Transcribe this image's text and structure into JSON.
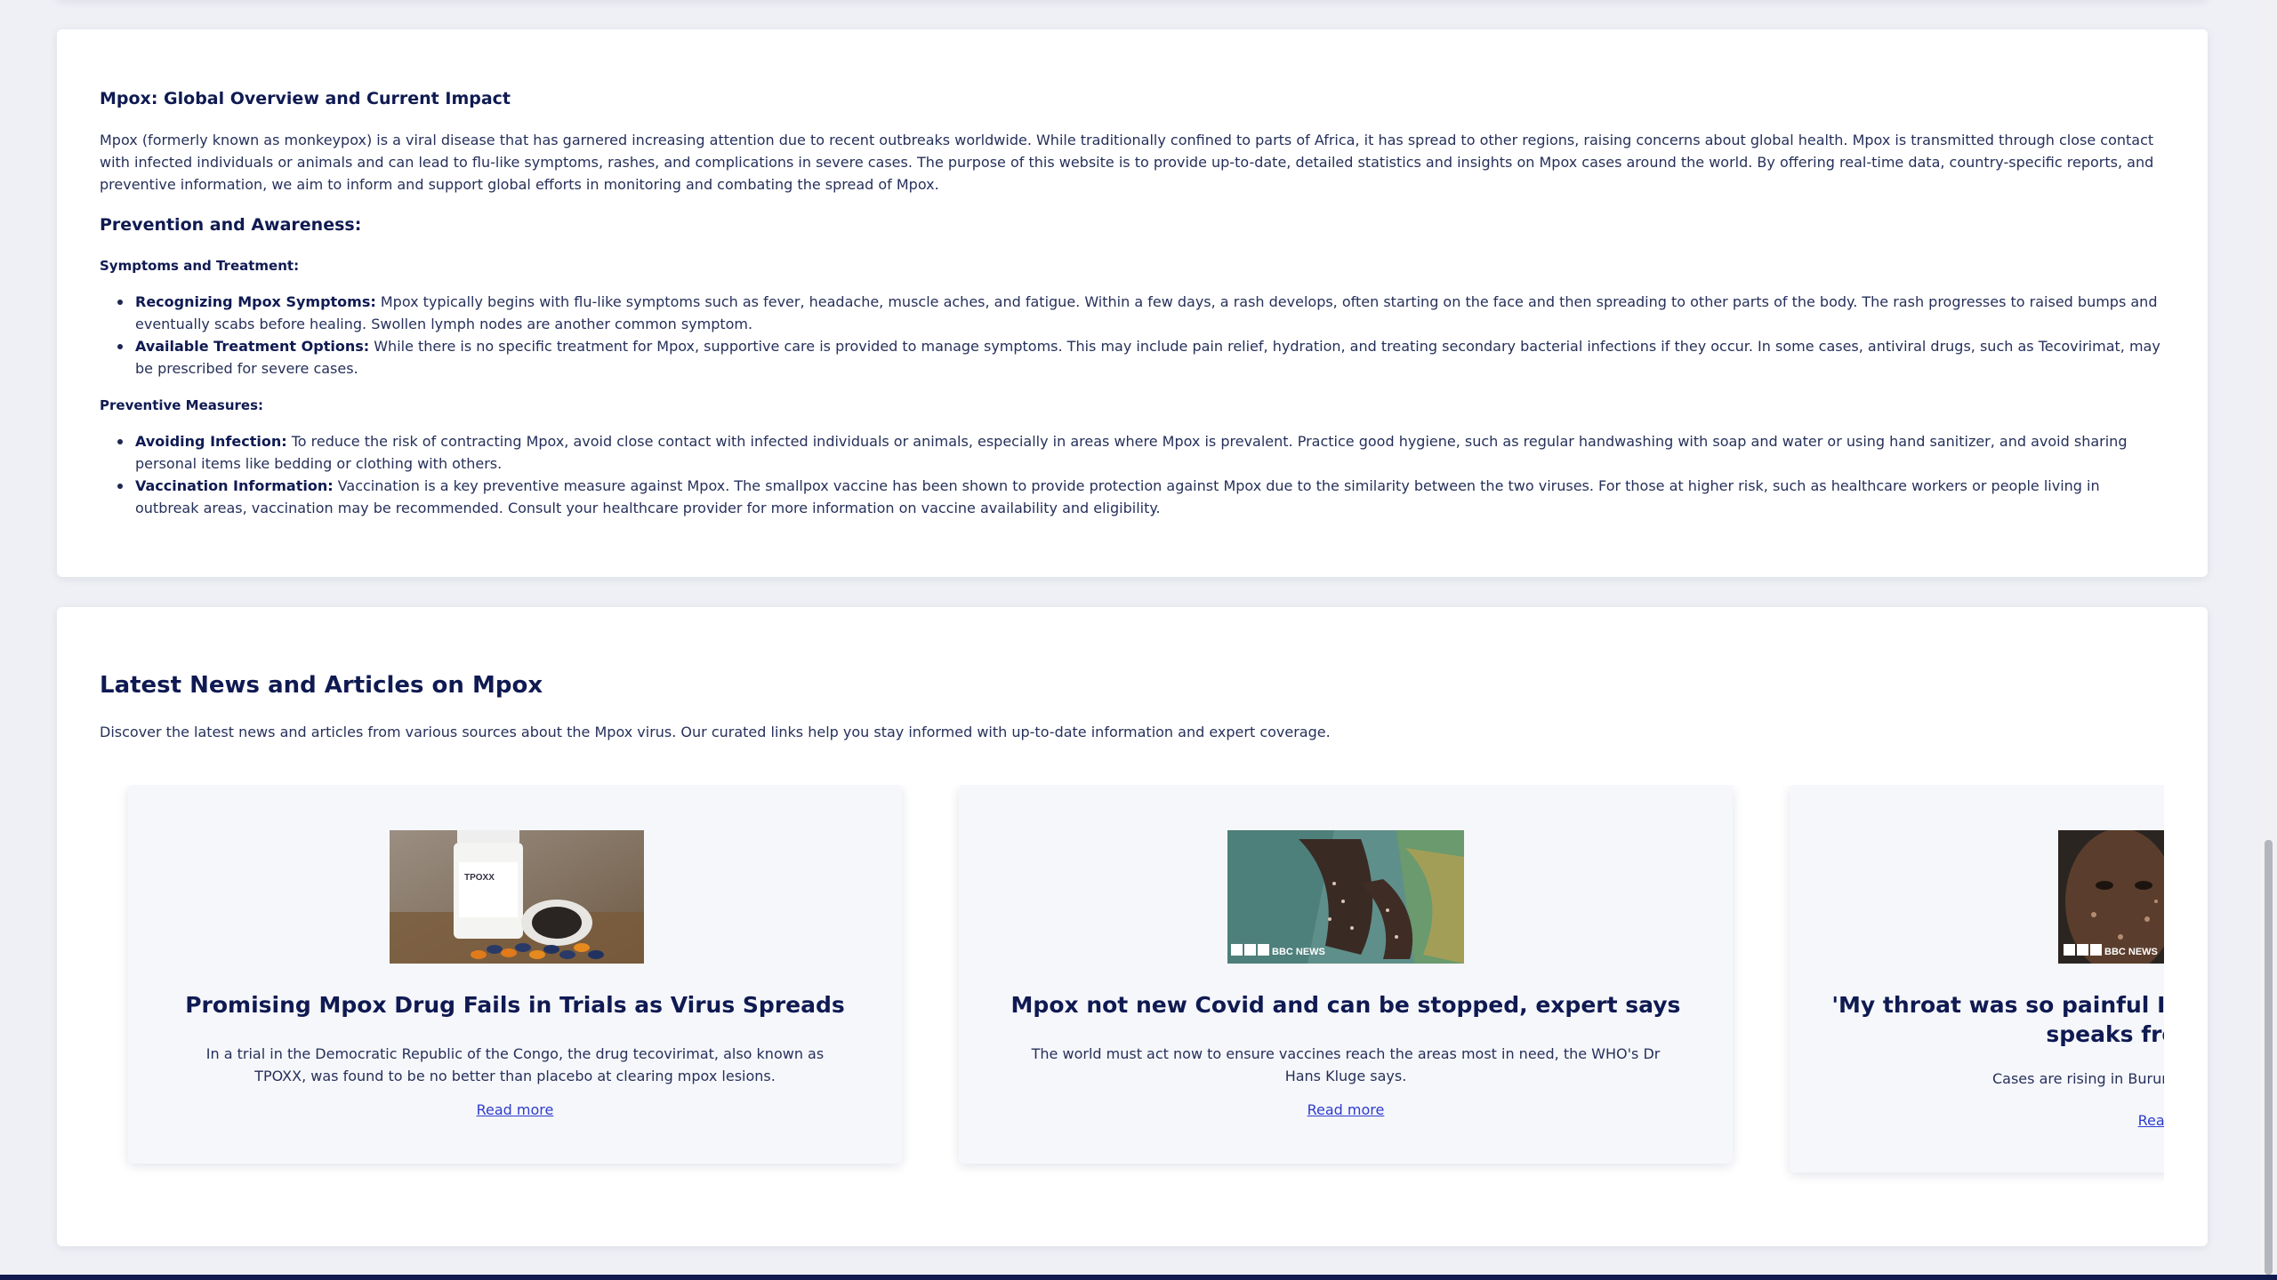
{
  "overview": {
    "title": "Mpox: Global Overview and Current Impact",
    "intro": "Mpox (formerly known as monkeypox) is a viral disease that has garnered increasing attention due to recent outbreaks worldwide. While traditionally confined to parts of Africa, it has spread to other regions, raising concerns about global health. Mpox is transmitted through close contact with infected individuals or animals and can lead to flu-like symptoms, rashes, and complications in severe cases. The purpose of this website is to provide up-to-date, detailed statistics and insights on Mpox cases around the world. By offering real-time data, country-specific reports, and preventive information, we aim to inform and support global efforts in monitoring and combating the spread of Mpox.",
    "prevention_heading": "Prevention and Awareness:",
    "symptoms_heading": "Symptoms and Treatment:",
    "symptoms_items": [
      {
        "label": "Recognizing Mpox Symptoms:",
        "text": " Mpox typically begins with flu-like symptoms such as fever, headache, muscle aches, and fatigue. Within a few days, a rash develops, often starting on the face and then spreading to other parts of the body. The rash progresses to raised bumps and eventually scabs before healing. Swollen lymph nodes are another common symptom."
      },
      {
        "label": "Available Treatment Options:",
        "text": " While there is no specific treatment for Mpox, supportive care is provided to manage symptoms. This may include pain relief, hydration, and treating secondary bacterial infections if they occur. In some cases, antiviral drugs, such as Tecovirimat, may be prescribed for severe cases."
      }
    ],
    "preventive_heading": "Preventive Measures:",
    "preventive_items": [
      {
        "label": "Avoiding Infection:",
        "text": " To reduce the risk of contracting Mpox, avoid close contact with infected individuals or animals, especially in areas where Mpox is prevalent. Practice good hygiene, such as regular handwashing with soap and water or using hand sanitizer, and avoid sharing personal items like bedding or clothing with others."
      },
      {
        "label": "Vaccination Information:",
        "text": " Vaccination is a key preventive measure against Mpox. The smallpox vaccine has been shown to provide protection against Mpox due to the similarity between the two viruses. For those at higher risk, such as healthcare workers or people living in outbreak areas, vaccination may be recommended. Consult your healthcare provider for more information on vaccine availability and eligibility."
      }
    ]
  },
  "news": {
    "title": "Latest News and Articles on Mpox",
    "description": "Discover the latest news and articles from various sources about the Mpox virus. Our curated links help you stay informed with up-to-date information and expert coverage.",
    "articles": [
      {
        "headline": "Promising Mpox Drug Fails in Trials as Virus Spreads",
        "summary": "In a trial in the Democratic Republic of the Congo, the drug tecovirimat, also known as TPOXX, was found to be no better than placebo at clearing mpox lesions.",
        "read_more": "Read more",
        "image_label": "TPOXX"
      },
      {
        "headline": "Mpox not new Covid and can be stopped, expert says",
        "summary": "The world must act now to ensure vaccines reach the areas most in need, the WHO's Dr Hans Kluge says.",
        "read_more": "Read more",
        "image_label": "BBC NEWS"
      },
      {
        "headline": "'My throat was so painful I couldn't eat' - mpox patient speaks from Burundi",
        "summary": "Cases are rising in Burundi as the virus moves from",
        "read_more": "Read more",
        "image_label": "BBC NEWS"
      }
    ]
  }
}
